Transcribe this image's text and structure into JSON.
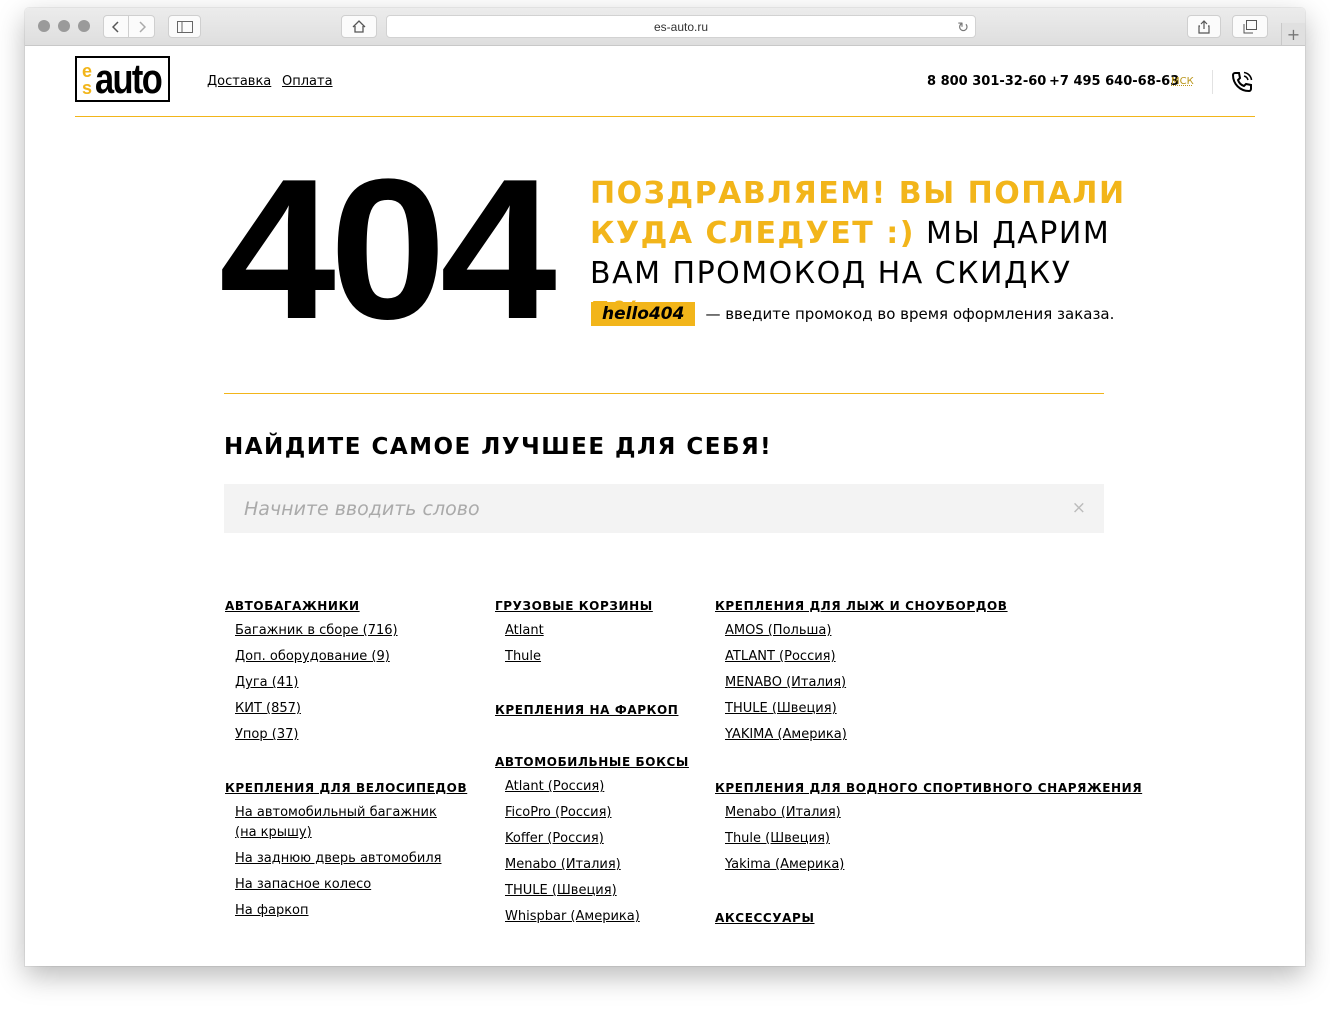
{
  "browser": {
    "url": "es-auto.ru"
  },
  "header": {
    "logo_e": "e",
    "logo_s": "s",
    "logo_auto": "auto",
    "nav": [
      "Доставка",
      "Оплата"
    ],
    "phone_1": "8 800 301-32-60",
    "phone_2": "+7 495 640-68-63",
    "city": "МСК"
  },
  "promo": {
    "code_big": "404",
    "title_yellow": "Поздравляем! Вы попали куда следует :)",
    "title_black": " мы дарим вам промокод на скидку ",
    "discount": "5%",
    "code": "hello404",
    "code_hint": "— введите промокод во время оформления заказа."
  },
  "search": {
    "title": "НАЙДИТЕ САМОЕ ЛУЧШЕЕ ДЛЯ СЕБЯ!",
    "placeholder": "Начните вводить слово",
    "clear": "×"
  },
  "catalog": {
    "col1": [
      {
        "title": "АВТОБАГАЖНИКИ",
        "items": [
          "Багажник в сборе (716)",
          "Доп. оборудование (9)",
          "Дуга (41)",
          "КИТ (857)",
          "Упор (37)"
        ]
      },
      {
        "title": "КРЕПЛЕНИЯ ДЛЯ ВЕЛОСИПЕДОВ",
        "items": [
          "На автомобильный багажник",
          "(на крышу)",
          "На заднюю дверь автомобиля",
          "На запасное колесо",
          "На фаркоп"
        ]
      }
    ],
    "col2": [
      {
        "title": "ГРУЗОВЫЕ КОРЗИНЫ",
        "items": [
          "Atlant",
          "Thule"
        ]
      },
      {
        "title": "КРЕПЛЕНИЯ НА ФАРКОП",
        "items": []
      },
      {
        "title": "АВТОМОБИЛЬНЫЕ БОКСЫ",
        "items": [
          "Atlant (Россия)",
          "FicoPro (Россия)",
          "Koffer (Россия)",
          "Menabo (Италия)",
          "THULE (Швеция)",
          "Whispbar (Америка)"
        ]
      }
    ],
    "col3": [
      {
        "title": "КРЕПЛЕНИЯ ДЛЯ ЛЫЖ И СНОУБОРДОВ",
        "items": [
          "AMOS (Польша)",
          "ATLANT (Россия)",
          "MENABO (Италия)",
          "THULE (Швеция)",
          "YAKIMA (Америка)"
        ]
      },
      {
        "title": "КРЕПЛЕНИЯ ДЛЯ ВОДНОГО СПОРТИВНОГО СНАРЯЖЕНИЯ",
        "items": [
          "Menabo (Италия)",
          "Thule (Швеция)",
          "Yakima (Америка)"
        ]
      },
      {
        "title": "АКСЕССУАРЫ",
        "items": []
      }
    ]
  }
}
